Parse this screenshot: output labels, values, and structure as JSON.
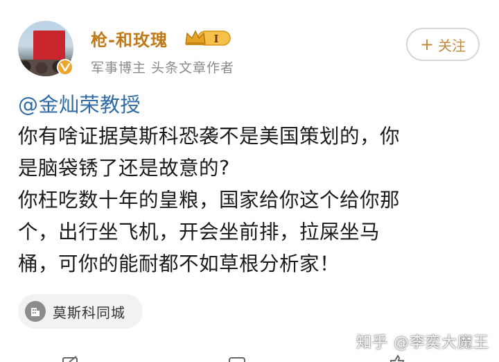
{
  "post": {
    "author": {
      "name": "枪-和玫瑰",
      "rank_badge": "I",
      "subtitle": "军事博主 头条文章作者"
    },
    "follow_label": "关注",
    "mention": "@金灿荣教授",
    "content_lines": [
      "你有啥证据莫斯科恐袭不是美国策划的，你",
      "是脑袋锈了还是故意的?",
      "你枉吃数十年的皇粮，国家给你这个给你那",
      "个，出行坐飞机，开会坐前排，拉屎坐马",
      "桶，可你的能耐都不如草根分析家！"
    ],
    "location": "莫斯科同城",
    "watermark": "知乎 @李奕大魔王"
  },
  "colors": {
    "username": "#c07a1a",
    "mention": "#2e6aa3",
    "verify_badge": "#f0a52a",
    "follow_text": "#c08a3a"
  },
  "icons": {
    "avatar": "user-avatar",
    "verify": "verified-v-icon",
    "rank": "crown-rank-icon",
    "location": "location-building-icon",
    "actions": [
      "share-icon",
      "comment-icon",
      "like-icon"
    ]
  }
}
